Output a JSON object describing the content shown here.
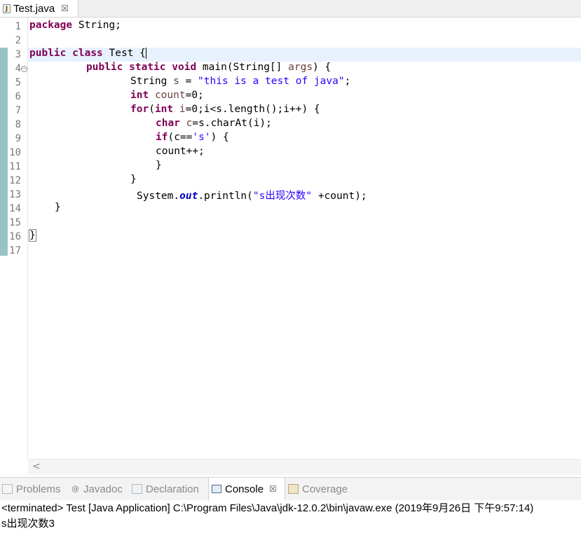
{
  "editor_tab": {
    "icon": "java-file-icon",
    "title": "Test.java",
    "close": "☒"
  },
  "editor": {
    "line_numbers": [
      "1",
      "2",
      "3",
      "4",
      "5",
      "6",
      "7",
      "8",
      "9",
      "10",
      "11",
      "12",
      "13",
      "14",
      "15",
      "16",
      "17"
    ],
    "code": {
      "l1": {
        "kw": "package",
        "rest": " String;"
      },
      "l3": {
        "kw1": "public",
        "kw2": "class",
        "rest": " Test {"
      },
      "l4": {
        "kw1": "public",
        "kw2": "static",
        "kw3": "void",
        "rest": " main(String[] ",
        "param": "args",
        "end": ") {"
      },
      "l5": {
        "pre": "String ",
        "var": "s",
        "mid": " = ",
        "str": "\"this is a test of java\"",
        "end": ";"
      },
      "l6": {
        "kw": "int",
        "var": "count",
        "end": "=0;"
      },
      "l7": {
        "kw1": "for",
        "p1": "(",
        "kw2": "int",
        "var": "i",
        "end": "=0;i<s.length();i++) {"
      },
      "l8": {
        "kw": "char",
        "var": "c",
        "end": "=s.charAt(i);"
      },
      "l9": {
        "kw": "if",
        "p1": "(c==",
        "str": "'s'",
        "end": ") {"
      },
      "l10": {
        "text": "count++;"
      },
      "l11": {
        "text": "}"
      },
      "l12": {
        "text": "}"
      },
      "l13": {
        "pre": "System.",
        "field": "out",
        "mid": ".println(",
        "str": "\"s出现次数\"",
        "end": " +count);"
      },
      "l14": {
        "text": "}"
      },
      "l16": {
        "text": "}"
      }
    },
    "scroll_arrow": "<"
  },
  "panel_tabs": [
    {
      "label": "Problems",
      "icon": "problems-icon"
    },
    {
      "label": "Javadoc",
      "icon": "javadoc-icon",
      "glyph": "@"
    },
    {
      "label": "Declaration",
      "icon": "declaration-icon"
    },
    {
      "label": "Console",
      "icon": "console-icon",
      "close": "☒",
      "active": true
    },
    {
      "label": "Coverage",
      "icon": "coverage-icon"
    }
  ],
  "console": {
    "header": "<terminated> Test [Java Application] C:\\Program Files\\Java\\jdk-12.0.2\\bin\\javaw.exe (2019年9月26日 下午9:57:14)",
    "output": "s出现次数3"
  },
  "colors": {
    "keyword": "#7f0055",
    "string": "#2a00ff",
    "variable": "#6a3e3e",
    "static_field": "#0000c0",
    "current_line": "#e8f2fe",
    "change_ruler": "#98c3c3"
  }
}
